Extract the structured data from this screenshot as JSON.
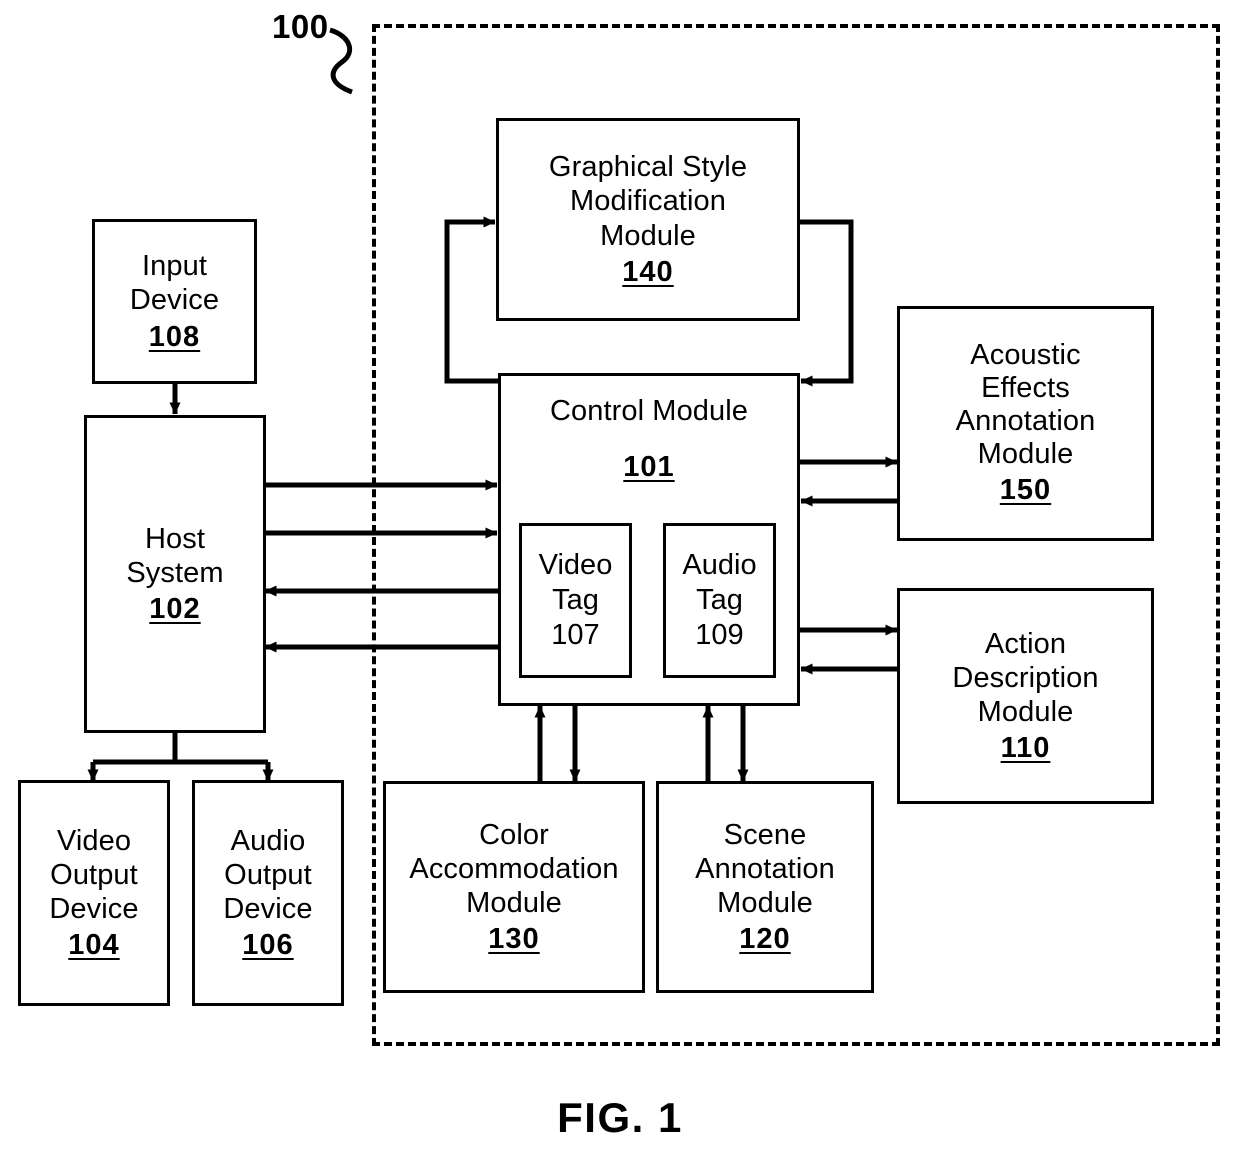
{
  "figure": {
    "caption": "FIG. 1",
    "system_callout": "100",
    "boundary_style": "dashed"
  },
  "blocks": {
    "input_device": {
      "title": "Input\nDevice",
      "refnum": "108"
    },
    "host_system": {
      "title": "Host\nSystem",
      "refnum": "102"
    },
    "video_output_device": {
      "title": "Video\nOutput\nDevice",
      "refnum": "104"
    },
    "audio_output_device": {
      "title": "Audio\nOutput\nDevice",
      "refnum": "106"
    },
    "graphical_style": {
      "title": "Graphical Style\nModification\nModule",
      "refnum": "140"
    },
    "control_module": {
      "title": "Control Module",
      "refnum": "101"
    },
    "video_tag": {
      "title": "Video\nTag",
      "refnum": "107"
    },
    "audio_tag": {
      "title": "Audio\nTag",
      "refnum": "109"
    },
    "acoustic_effects": {
      "title": "Acoustic\nEffects\nAnnotation\nModule",
      "refnum": "150"
    },
    "action_description": {
      "title": "Action\nDescription\nModule",
      "refnum": "110"
    },
    "color_accommodation": {
      "title": "Color\nAccommodation\nModule",
      "refnum": "130"
    },
    "scene_annotation": {
      "title": "Scene\nAnnotation\nModule",
      "refnum": "120"
    }
  },
  "colors": {
    "stroke": "#000000",
    "background": "#ffffff"
  },
  "connections": [
    {
      "name": "input-device-to-host-system",
      "from": "input_device",
      "to": "host_system",
      "direction": "down"
    },
    {
      "name": "host-system-to-video-output-device",
      "from": "host_system",
      "to": "video_output_device",
      "direction": "down"
    },
    {
      "name": "host-system-to-audio-output-device",
      "from": "host_system",
      "to": "audio_output_device",
      "direction": "down"
    },
    {
      "name": "host-system-to-control-module-1",
      "from": "host_system",
      "to": "control_module",
      "direction": "right"
    },
    {
      "name": "host-system-to-control-module-2",
      "from": "host_system",
      "to": "control_module",
      "direction": "right"
    },
    {
      "name": "control-module-to-host-system-1",
      "from": "control_module",
      "to": "host_system",
      "direction": "left"
    },
    {
      "name": "control-module-to-host-system-2",
      "from": "control_module",
      "to": "host_system",
      "direction": "left"
    },
    {
      "name": "control-module-to-graphical-style",
      "from": "control_module",
      "to": "graphical_style",
      "direction": "loop-left"
    },
    {
      "name": "graphical-style-to-control-module",
      "from": "graphical_style",
      "to": "control_module",
      "direction": "loop-right"
    },
    {
      "name": "control-module-to-acoustic-effects",
      "from": "control_module",
      "to": "acoustic_effects",
      "direction": "right"
    },
    {
      "name": "acoustic-effects-to-control-module",
      "from": "acoustic_effects",
      "to": "control_module",
      "direction": "left"
    },
    {
      "name": "control-module-to-action-description",
      "from": "control_module",
      "to": "action_description",
      "direction": "right"
    },
    {
      "name": "action-description-to-control-module",
      "from": "action_description",
      "to": "control_module",
      "direction": "left"
    },
    {
      "name": "color-accommodation-to-control-module",
      "from": "color_accommodation",
      "to": "control_module",
      "direction": "up"
    },
    {
      "name": "control-module-to-color-accommodation",
      "from": "control_module",
      "to": "color_accommodation",
      "direction": "down"
    },
    {
      "name": "scene-annotation-to-control-module",
      "from": "scene_annotation",
      "to": "control_module",
      "direction": "up"
    },
    {
      "name": "control-module-to-scene-annotation",
      "from": "control_module",
      "to": "scene_annotation",
      "direction": "down"
    }
  ]
}
